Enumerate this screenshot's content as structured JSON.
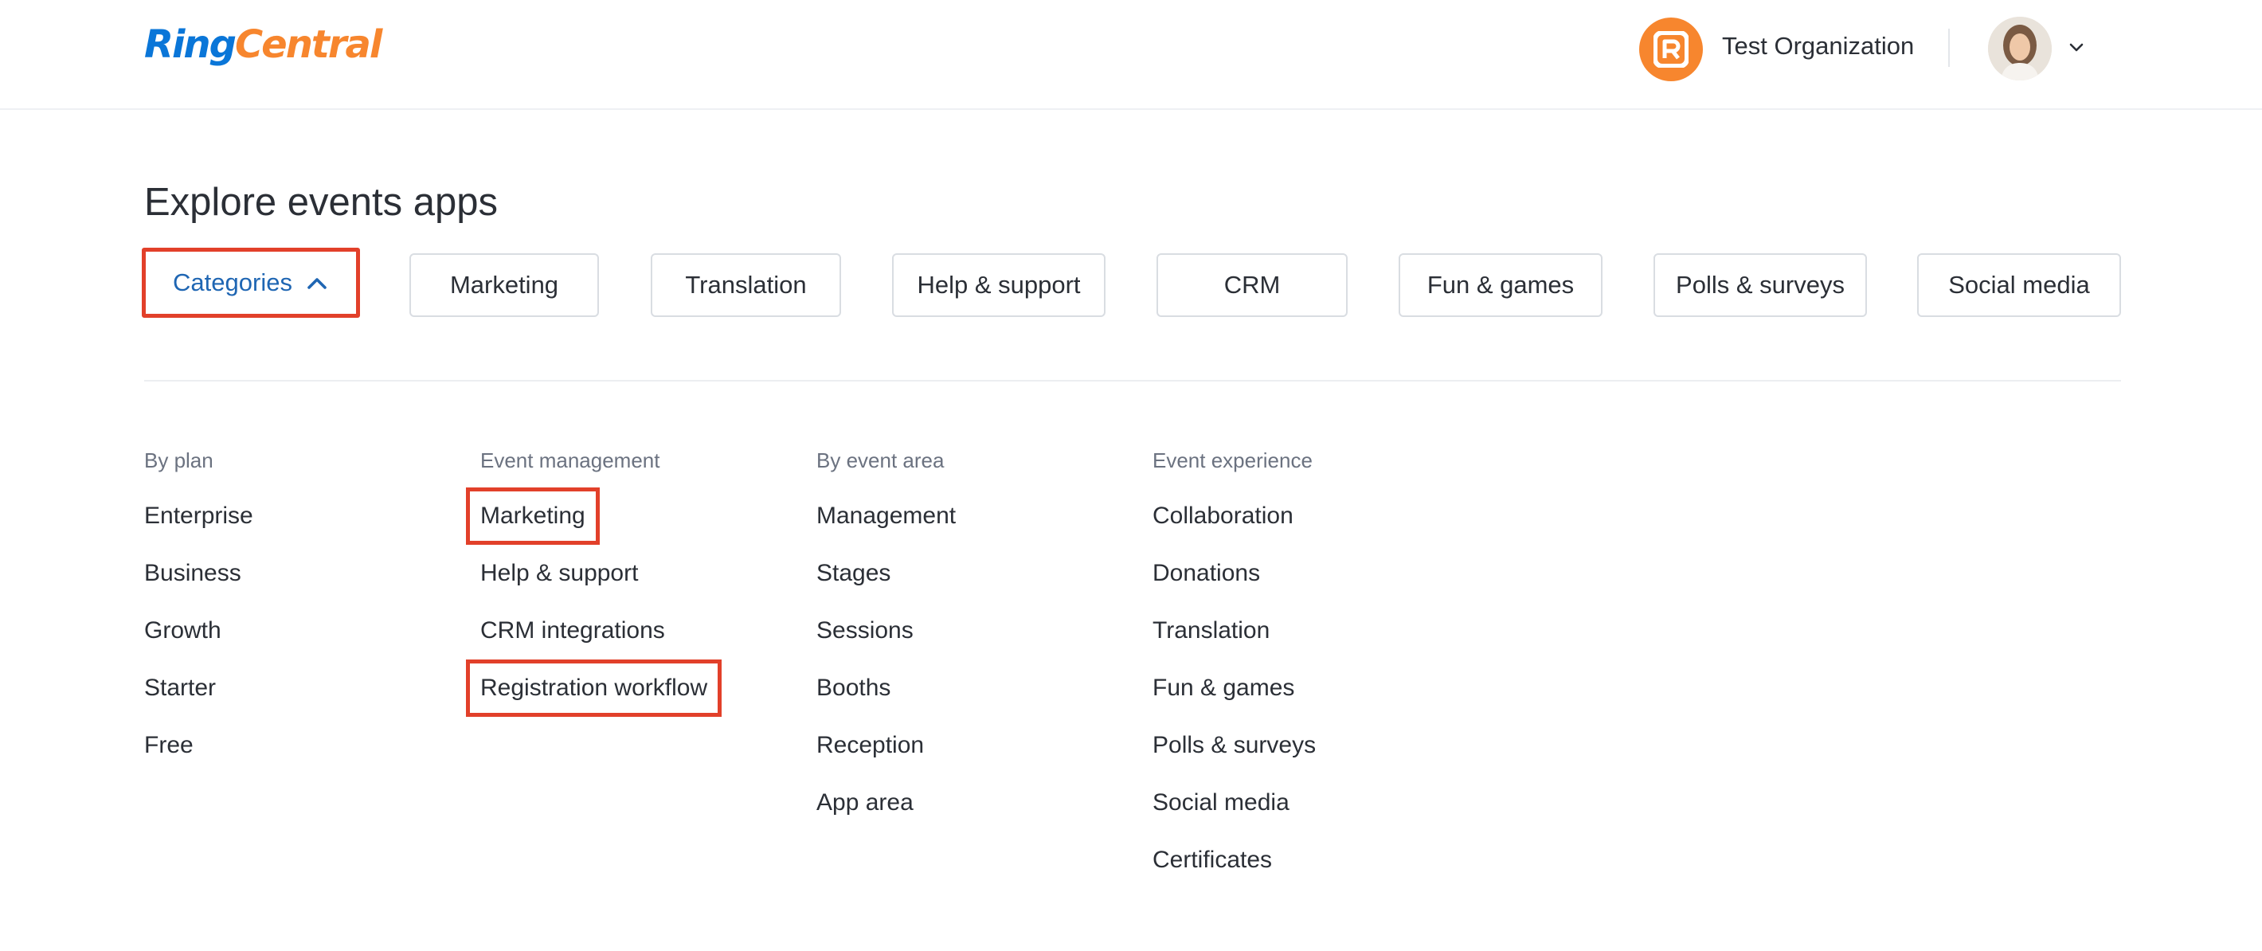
{
  "header": {
    "logo": {
      "ring": "Ring",
      "central": "Central"
    },
    "org_avatar_letter": "R",
    "org_name": "Test Organization"
  },
  "page": {
    "title": "Explore events apps"
  },
  "chips": [
    {
      "label": "Categories",
      "active": true
    },
    {
      "label": "Marketing"
    },
    {
      "label": "Translation"
    },
    {
      "label": "Help & support"
    },
    {
      "label": "CRM"
    },
    {
      "label": "Fun & games"
    },
    {
      "label": "Polls & surveys"
    },
    {
      "label": "Social media"
    }
  ],
  "columns": [
    {
      "heading": "By plan",
      "items": [
        "Enterprise",
        "Business",
        "Growth",
        "Starter",
        "Free"
      ]
    },
    {
      "heading": "Event management",
      "items": [
        "Marketing",
        "Help & support",
        "CRM integrations",
        "Registration workflow"
      ]
    },
    {
      "heading": "By event area",
      "items": [
        "Management",
        "Stages",
        "Sessions",
        "Booths",
        "Reception",
        "App area"
      ]
    },
    {
      "heading": "Event experience",
      "items": [
        "Collaboration",
        "Donations",
        "Translation",
        "Fun & games",
        "Polls & surveys",
        "Social media",
        "Certificates"
      ]
    }
  ],
  "colors": {
    "accent_blue": "#1f66b3",
    "brand_orange": "#f7862e",
    "highlight_red": "#e2402a"
  }
}
